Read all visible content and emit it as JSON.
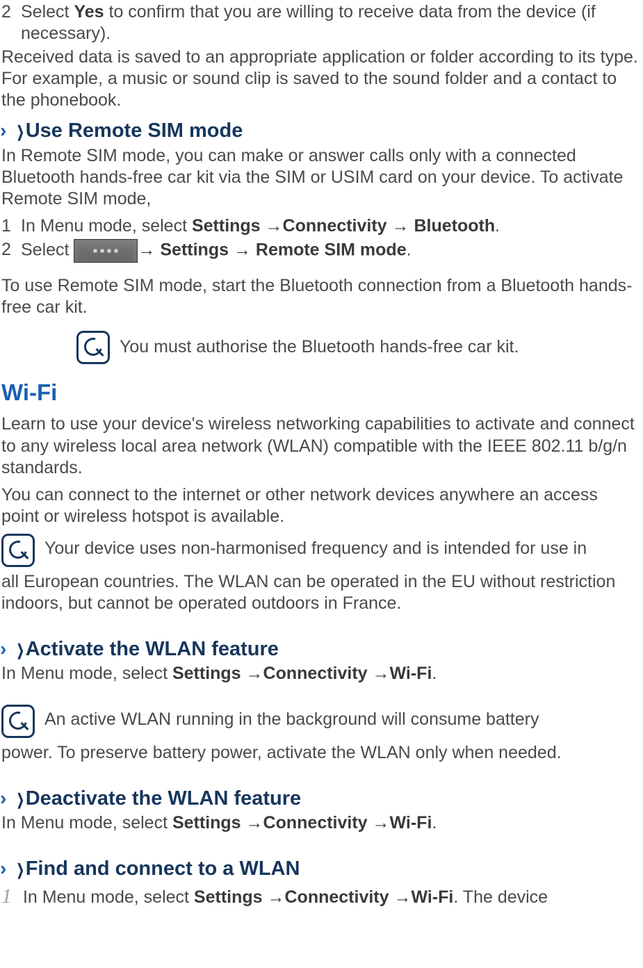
{
  "step2_prefix": "Select ",
  "step2_bold": "Yes",
  "step2_suffix": " to confirm that you are willing to receive data from the device (if necessary).",
  "para_received": "Received data is saved to an appropriate application or folder according to its type. For example, a music or sound clip is saved to the sound folder and a contact to the phonebook.",
  "h_remote_sim": "Use Remote SIM mode",
  "para_remote_sim": "In Remote SIM mode, you can make or answer calls only with a connected Bluetooth hands-free car kit via the SIM or USIM card on your device. To activate Remote SIM mode,",
  "s1_prefix": "In Menu mode, select ",
  "s1_b1": "Settings ",
  "s1_arrow1": "→",
  "s1_b2": "Connectivity ",
  "s1_arrow2": "→ ",
  "s1_b3": "Bluetooth",
  "s2_prefix": "Select  ",
  "s2_b1": "→ Settings → Remote SIM mode",
  "para_remote_use": "To use Remote SIM mode, start the Bluetooth connection from a Bluetooth hands-free car kit.",
  "note_authorise": "You must authorise the Bluetooth hands-free car kit.",
  "h_wifi": "Wi-Fi",
  "para_wifi1": "Learn to use your device's wireless networking capabilities to activate and connect to any wireless local area network (WLAN) compatible with the IEEE 802.11 b/g/n standards.",
  "para_wifi2": "You can connect to the internet or other network devices anywhere an access point or wireless hotspot is available.",
  "note_eu1": "Your device uses non-harmonised frequency and is intended for use in",
  "note_eu2": "all European countries. The WLAN can be operated in the EU without restriction indoors, but cannot be operated outdoors in France.",
  "h_activate": "Activate the WLAN feature",
  "act_prefix": "In Menu mode, select ",
  "act_b1": "Settings ",
  "act_b2": "Connectivity ",
  "act_b3": "Wi-Fi",
  "note_batt1": "An active WLAN running in the background will consume battery",
  "note_batt2": "power. To preserve battery power, activate the WLAN only when needed.",
  "h_deactivate": "Deactivate the WLAN feature",
  "h_find": "Find and connect to a WLAN",
  "find_suffix": ". The device",
  "num1": "1",
  "num2": "2",
  "dot": "."
}
